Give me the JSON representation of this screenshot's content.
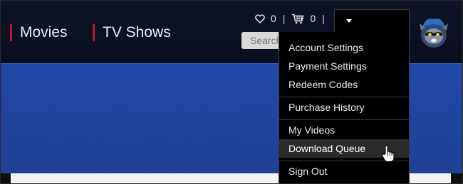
{
  "nav": {
    "items": [
      {
        "label": "Movies"
      },
      {
        "label": "TV Shows"
      }
    ]
  },
  "toolbar": {
    "wishlist_count": "0",
    "cart_count": "0",
    "separator": "|"
  },
  "search": {
    "placeholder": "Search"
  },
  "account_menu": {
    "items": [
      {
        "label": "Account Settings"
      },
      {
        "label": "Payment Settings"
      },
      {
        "label": "Redeem Codes"
      },
      {
        "label": "Purchase History"
      },
      {
        "label": "My Videos"
      },
      {
        "label": "Download Queue"
      },
      {
        "label": "Sign Out"
      }
    ],
    "hovered_item": "Download Queue"
  },
  "colors": {
    "accent_red": "#c8102e",
    "banner_blue": "#1e47a6",
    "header_bg": "#0e1326",
    "menu_bg": "#000000"
  },
  "icons": [
    "heart-icon",
    "cart-icon",
    "caret-down-icon",
    "avatar",
    "hand-cursor-icon"
  ]
}
